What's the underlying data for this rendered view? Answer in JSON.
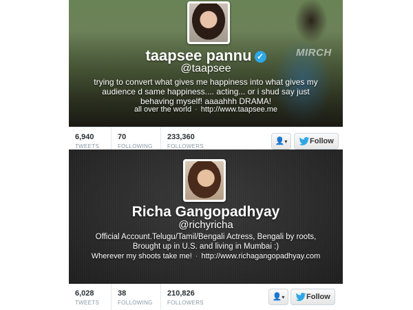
{
  "profiles": [
    {
      "name": "taapsee pannu",
      "verified": true,
      "handle": "@taapsee",
      "bio": "trying to convert what gives me happiness into what gives my audience d same happiness.... acting... or i shud say just behaving myself! aaaahhh DRAMA!",
      "location": "all over the world",
      "separator": "·",
      "url": "http://www.taapsee.me",
      "watermark": "MIRCH",
      "stats": {
        "tweets": {
          "value": "6,940",
          "label": "TWEETS"
        },
        "following": {
          "value": "70",
          "label": "FOLLOWING"
        },
        "followers": {
          "value": "233,360",
          "label": "FOLLOWERS"
        }
      },
      "follow_label": "Follow",
      "icons": {
        "verified": "verified-check-icon",
        "user_menu": "user-icon",
        "dropdown": "caret-down-icon",
        "follow": "twitter-bird-icon"
      }
    },
    {
      "name": "Richa Gangopadhyay",
      "verified": false,
      "handle": "@richyricha",
      "bio": "Official Account.Telugu/Tamil/Bengali Actress, Bengali by roots, Brought up in U.S. and living in Mumbai :)",
      "location": "Wherever my shoots take me!",
      "separator": "·",
      "url": "http://www.richagangopadhyay.com",
      "stats": {
        "tweets": {
          "value": "6,028",
          "label": "TWEETS"
        },
        "following": {
          "value": "38",
          "label": "FOLLOWING"
        },
        "followers": {
          "value": "210,826",
          "label": "FOLLOWERS"
        }
      },
      "follow_label": "Follow",
      "icons": {
        "user_menu": "user-icon",
        "dropdown": "caret-down-icon",
        "follow": "twitter-bird-icon"
      }
    }
  ],
  "colors": {
    "verified_badge": "#2fa7e6",
    "twitter_bird": "#2fa7e6",
    "stat_value": "#292f33",
    "stat_label": "#8899a6"
  }
}
